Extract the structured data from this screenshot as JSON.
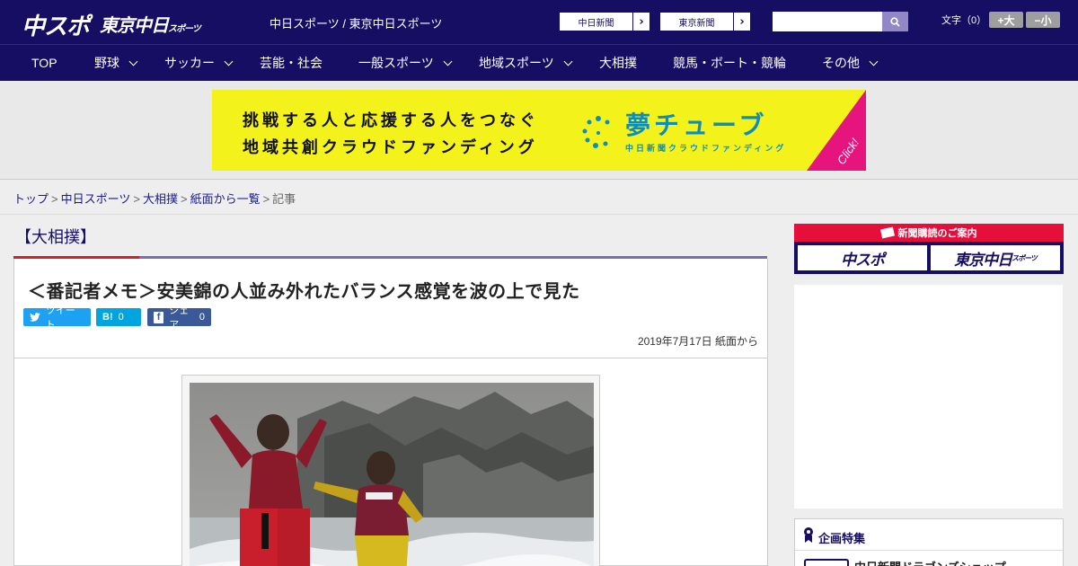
{
  "header": {
    "logo_chuspo": "中スポ",
    "logo_tokyo": "東京中日",
    "logo_tokyo_small": "スポーツ",
    "site_title": "中日スポーツ / 東京中日スポーツ",
    "paper_links": [
      {
        "label": "中日新聞"
      },
      {
        "label": "東京新聞"
      }
    ],
    "search_placeholder": "",
    "text_size_label": "文字（0）",
    "size_up": "+大",
    "size_down": "−小"
  },
  "nav": {
    "items": [
      {
        "label": "TOP",
        "dropdown": false
      },
      {
        "label": "野球",
        "dropdown": true
      },
      {
        "label": "サッカー",
        "dropdown": true
      },
      {
        "label": "芸能・社会",
        "dropdown": false
      },
      {
        "label": "一般スポーツ",
        "dropdown": true
      },
      {
        "label": "地域スポーツ",
        "dropdown": true
      },
      {
        "label": "大相撲",
        "dropdown": false
      },
      {
        "label": "競馬・ボート・競輪",
        "dropdown": false
      },
      {
        "label": "その他",
        "dropdown": true
      }
    ]
  },
  "banner": {
    "line1": "挑戦する人と応援する人をつなぐ",
    "line2": "地域共創クラウドファンディング",
    "brand": "夢チューブ",
    "brand_sub": "中日新聞クラウドファンディング",
    "click": "Click!",
    "bg_color": "#f4f21b",
    "brand_color": "#0a8ec0",
    "corner_color": "#e6157e"
  },
  "breadcrumb": {
    "items": [
      "トップ",
      "中日スポーツ",
      "大相撲",
      "紙面から一覧"
    ],
    "current": "記事"
  },
  "article": {
    "category": "【大相撲】",
    "title": "＜番記者メモ＞安美錦の人並み外れたバランス感覚を波の上で見た",
    "share": {
      "tweet_label": "ツイート",
      "hatena_icon": "B!",
      "hatena_count": "0",
      "fb_icon": "f",
      "fb_label": "シェア",
      "fb_count": "0"
    },
    "date": "2019年7月17日 紙面から"
  },
  "sidebar": {
    "subscribe_head": "新聞購読のご案内",
    "subscribe_logos": [
      "中スポ",
      "東京中日"
    ],
    "subscribe_logo_small": "スポーツ",
    "feature_title": "企画特集",
    "feature_item": "中日新聞ドラゴンズショップ"
  },
  "colors": {
    "brand_navy": "#150e63",
    "accent_red": "#d81e2a",
    "accent_purple": "#7a6db3",
    "subscribe_red": "#e60f3c",
    "twitter": "#1da1f2",
    "hatena": "#00a4de",
    "facebook": "#3b5998"
  }
}
